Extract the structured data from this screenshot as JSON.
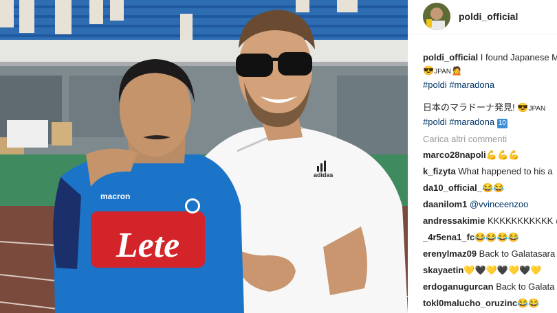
{
  "post": {
    "author": "poldi_official",
    "caption_username": "poldi_official",
    "caption_text": "I found Japanese M",
    "caption_line2_text": "JPAN",
    "hashtag_1": "#poldi",
    "hashtag_2": "#maradona",
    "second_text": "日本のマラドーナ発見!",
    "second_suffix": "JPAN",
    "hashtag_3": "#poldi",
    "hashtag_4": "#maradona",
    "ten_badge": "10"
  },
  "load_more": "Carica altri commenti",
  "comments": [
    {
      "user": "marco28napoli",
      "text": "",
      "emojis": "💪💪💪"
    },
    {
      "user": "k_fizyta",
      "text": "What happened to his a",
      "emojis": ""
    },
    {
      "user": "da10_official_",
      "text": "",
      "emojis": "😂😂"
    },
    {
      "user": "daanilom1",
      "text": "@vvinceenzoo",
      "emojis": "",
      "mention": true
    },
    {
      "user": "andressakimie",
      "text": "KKKKKKKKKKK @",
      "emojis": ""
    },
    {
      "user": "_4r5ena1_fc",
      "text": "",
      "emojis": "😂😂😂😂"
    },
    {
      "user": "erenylmaz09",
      "text": "Back to Galatasara",
      "emojis": ""
    },
    {
      "user": "skayaetin",
      "text": "",
      "emojis": "💛🖤💛🖤💛🖤💛"
    },
    {
      "user": "erdoganugurcan",
      "text": "Back to Galata",
      "emojis": ""
    },
    {
      "user": "tokl0malucho_oruzinc",
      "text": "",
      "emojis": "😂😂"
    }
  ],
  "jersey_text": "Lete",
  "jersey_brand": "macron",
  "shirt_brand": "adidas"
}
